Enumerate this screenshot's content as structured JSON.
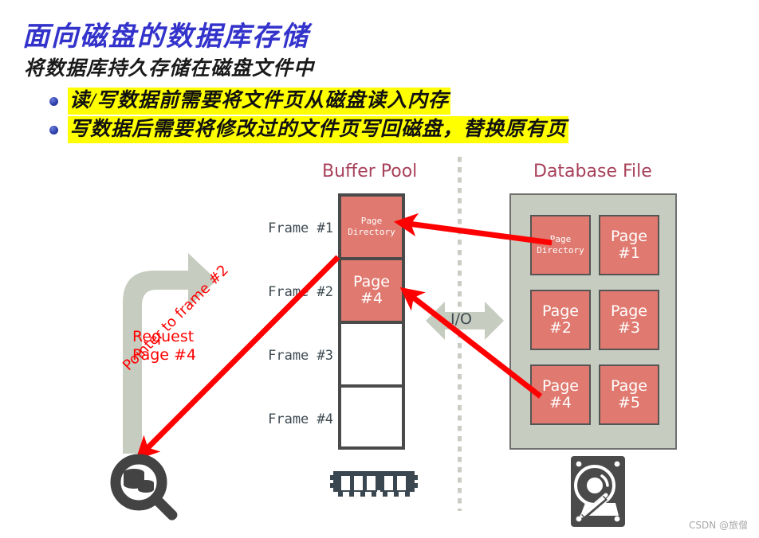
{
  "slide": {
    "title": "面向磁盘的数据库存储",
    "subtitle": "将数据库持久存储在磁盘文件中",
    "bullets": [
      "读/写数据前需要将文件页从磁盘读入内存",
      "写数据后需要将修改过的文件页写回磁盘，替换原有页"
    ],
    "title_color": "#3333cc",
    "highlight_color": "#ffff00",
    "bullet_color": "#2b3ea8"
  },
  "diagram": {
    "buffer_pool": {
      "header": "Buffer Pool",
      "header_color": "#a8415a",
      "frames": [
        {
          "label": "Frame #1",
          "content": "Page\nDirectory",
          "content_line1": "Page",
          "content_line2": "Directory",
          "filled": true,
          "style": "small"
        },
        {
          "label": "Frame #2",
          "content": "Page\n#4",
          "content_line1": "Page",
          "content_line2": "#4",
          "filled": true,
          "style": "big"
        },
        {
          "label": "Frame #3",
          "content": "",
          "content_line1": "",
          "content_line2": "",
          "filled": false,
          "style": "big"
        },
        {
          "label": "Frame #4",
          "content": "",
          "content_line1": "",
          "content_line2": "",
          "filled": false,
          "style": "big"
        }
      ],
      "page_color": "#e0796f",
      "border_color": "#4a4a4a"
    },
    "database_file": {
      "header": "Database File",
      "header_color": "#a8415a",
      "background_color": "#c6ccc0",
      "pages": [
        {
          "line1": "Page",
          "line2": "Directory",
          "style": "small"
        },
        {
          "line1": "Page",
          "line2": "#1",
          "style": "big"
        },
        {
          "line1": "Page",
          "line2": "#2",
          "style": "big"
        },
        {
          "line1": "Page",
          "line2": "#3",
          "style": "big"
        },
        {
          "line1": "Page",
          "line2": "#4",
          "style": "big"
        },
        {
          "line1": "Page",
          "line2": "#5",
          "style": "big"
        }
      ],
      "page_color": "#e0796f"
    },
    "io": {
      "label": "I/O",
      "arrow_color": "#c9cdc4"
    },
    "annotations": {
      "request_line1": "Request",
      "request_line2": "Page #4",
      "pointer_label": "Pointer to frame #2",
      "arrow_color": "#ff0000"
    },
    "icons": {
      "query": "database-search-icon",
      "memory": "ram-module-icon",
      "disk": "hard-disk-icon",
      "flow": "curved-flow-arrow-icon"
    }
  },
  "watermark": "CSDN @旅僧"
}
